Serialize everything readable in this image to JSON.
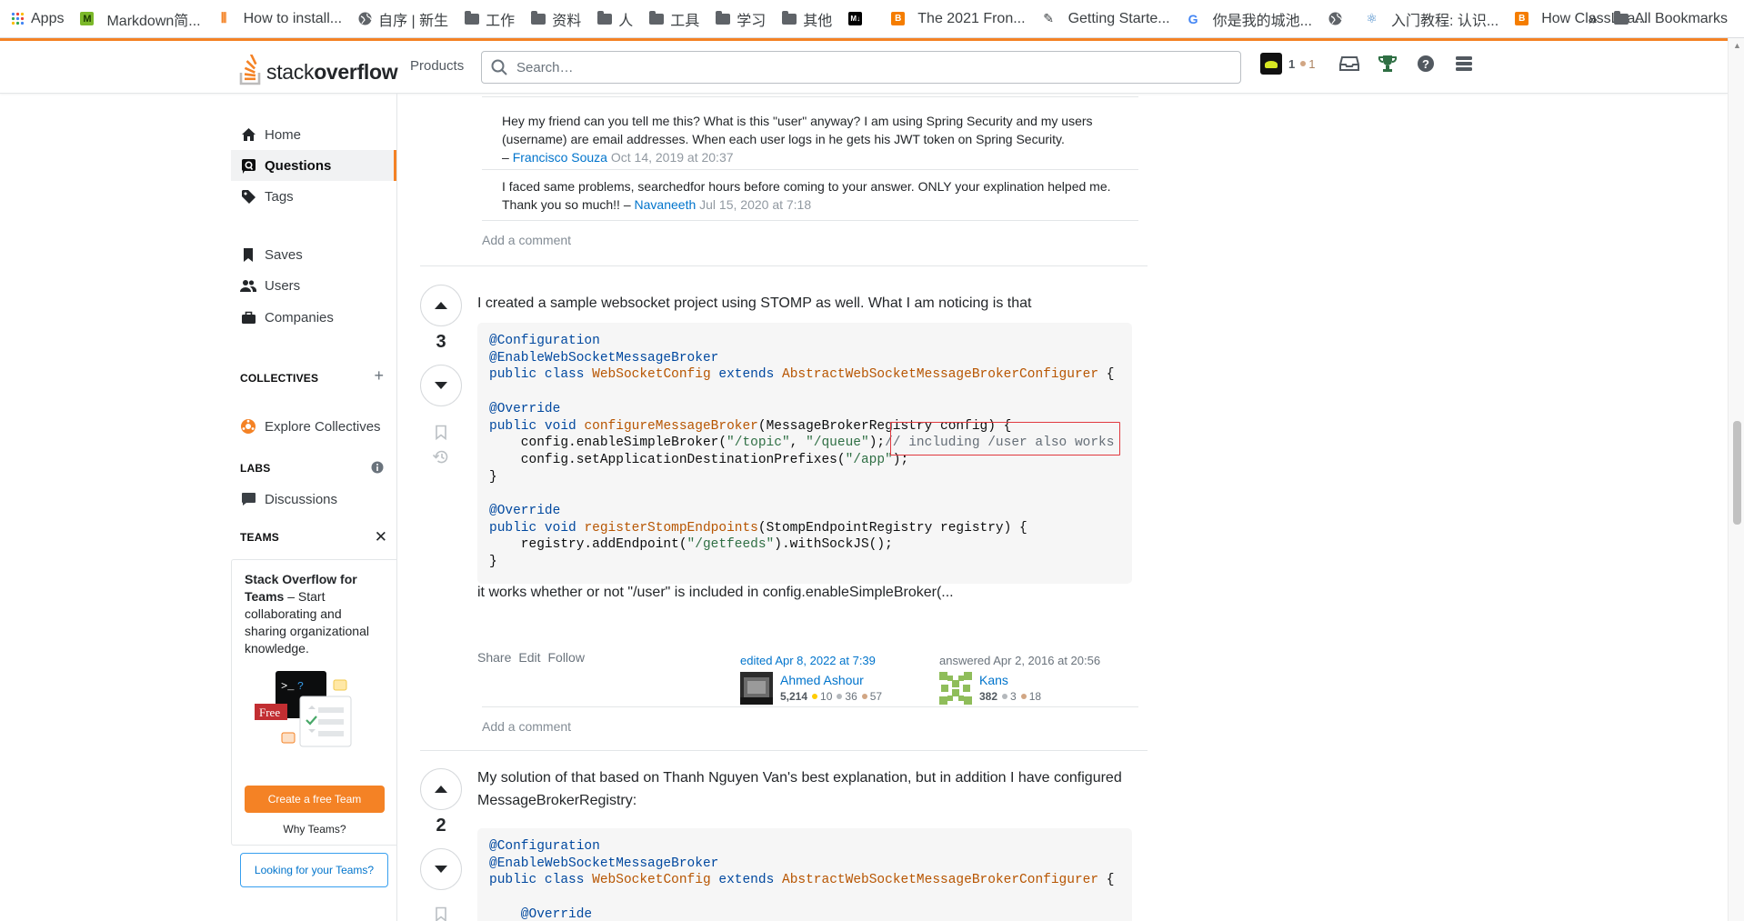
{
  "bookmarks": {
    "items": [
      {
        "label": "Apps",
        "icon": "apps-grid-icon"
      },
      {
        "label": "Markdown简...",
        "icon": "markdown-icon"
      },
      {
        "label": "How to install...",
        "icon": "site-icon"
      },
      {
        "label": "自序 | 新生",
        "icon": "globe-icon"
      },
      {
        "label": "工作",
        "icon": "folder-icon"
      },
      {
        "label": "资料",
        "icon": "folder-icon"
      },
      {
        "label": "人",
        "icon": "folder-icon"
      },
      {
        "label": "工具",
        "icon": "folder-icon"
      },
      {
        "label": "学习",
        "icon": "folder-icon"
      },
      {
        "label": "其他",
        "icon": "folder-icon"
      },
      {
        "label": "",
        "icon": "dev-icon"
      },
      {
        "label": "The 2021 Fron...",
        "icon": "blogger-icon"
      },
      {
        "label": "Getting Starte...",
        "icon": "doc-icon"
      },
      {
        "label": "你是我的城池...",
        "icon": "google-icon"
      },
      {
        "label": "",
        "icon": "globe-icon"
      },
      {
        "label": "入门教程: 认识...",
        "icon": "react-icon"
      },
      {
        "label": "How ClassLoa...",
        "icon": "blogger-icon"
      }
    ],
    "more": "»",
    "all_bookmarks": "All Bookmarks"
  },
  "header": {
    "logo_stack": "stack",
    "logo_overflow": "overflow",
    "products": "Products",
    "search_placeholder": "Search…",
    "rep_count": "1",
    "bronze_count": "1"
  },
  "nav": {
    "home": "Home",
    "questions": "Questions",
    "tags": "Tags",
    "saves": "Saves",
    "users": "Users",
    "companies": "Companies",
    "collectives_header": "COLLECTIVES",
    "explore_collectives": "Explore Collectives",
    "labs_header": "LABS",
    "discussions": "Discussions",
    "teams_header": "TEAMS",
    "teams_title_bold": "Stack Overflow for Teams",
    "teams_desc": " – Start collaborating and sharing organizational knowledge.",
    "free_badge": "Free",
    "create_team": "Create a free Team",
    "why_teams": "Why Teams?",
    "looking_teams": "Looking for your Teams?"
  },
  "comments": [
    {
      "text": "Hey my friend can you tell me this? What is this \"user\" anyway? I am using Spring Security and my users (username) are email addresses. When each user logs in he gets his JWT token on Spring Security.",
      "dash": "– ",
      "author": "Francisco Souza",
      "date": "Oct 14, 2019 at 20:37"
    },
    {
      "text": "I faced same problems, searchedfor hours before coming to your answer. ONLY your explination helped me. Thank you so much!! – ",
      "author": "Navaneeth",
      "date": "Jul 15, 2020 at 7:18"
    }
  ],
  "add_comment": "Add a comment",
  "answer1": {
    "votes": "3",
    "intro": "I created a sample websocket project using STOMP as well. What I am noticing is that",
    "code": {
      "l1": "@Configuration",
      "l2": "@EnableWebSocketMessageBroker",
      "l3_public": "public",
      "l3_class": "class",
      "l3_name": "WebSocketConfig",
      "l3_extends": "extends",
      "l3_parent": "AbstractWebSocketMessageBrokerConfigurer",
      "l3_brace": " {",
      "l5": "@Override",
      "l6_public": "public",
      "l6_void": "void",
      "l6_fn": "configureMessageBroker",
      "l6_rest": "(MessageBrokerRegistry config) {",
      "l7_pre": "    config.enableSimpleBroker(",
      "l7_topic": "\"/topic\"",
      "l7_comma": ", ",
      "l7_queue": "\"/queue\"",
      "l7_post": ");",
      "l7_comment": "// including /user also works",
      "l8_pre": "    config.setApplicationDestinationPrefixes(",
      "l8_app": "\"/app\"",
      "l8_post": ");",
      "l9": "}",
      "l11": "@Override",
      "l12_public": "public",
      "l12_void": "void",
      "l12_fn": "registerStompEndpoints",
      "l12_rest": "(StompEndpointRegistry registry) {",
      "l13_pre": "    registry.addEndpoint(",
      "l13_str": "\"/getfeeds\"",
      "l13_post": ").withSockJS();",
      "l14": "}"
    },
    "outro": "it works whether or not \"/user\" is included in config.enableSimpleBroker(...",
    "share": "Share",
    "edit": "Edit",
    "follow": "Follow",
    "edited": "edited Apr 8, 2022 at 7:39",
    "editor_name": "Ahmed Ashour",
    "editor_rep": "5,214",
    "editor_gold": "10",
    "editor_silver": "36",
    "editor_bronze": "57",
    "answered": "answered Apr 2, 2016 at 20:56",
    "author_name": "Kans",
    "author_rep": "382",
    "author_silver": "3",
    "author_bronze": "18"
  },
  "answer2": {
    "votes": "2",
    "intro": "My solution of that based on Thanh Nguyen Van's best explanation, but in addition I have configured MessageBrokerRegistry:",
    "code": {
      "l1": "@Configuration",
      "l2": "@EnableWebSocketMessageBroker",
      "l3_public": "public",
      "l3_class": "class",
      "l3_name": "WebSocketConfig",
      "l3_extends": "extends",
      "l3_parent": "AbstractWebSocketMessageBrokerConfigurer",
      "l3_brace": " {",
      "l5": "    @Override"
    }
  },
  "colors": {
    "accent": "#f48225",
    "link": "#0074cc",
    "highlight_box": "#e0383e"
  }
}
